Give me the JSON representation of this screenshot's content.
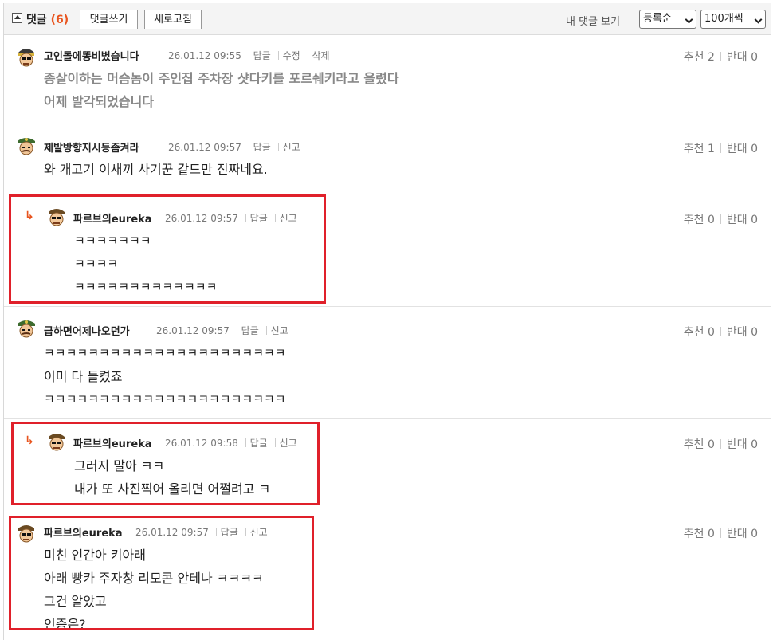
{
  "header": {
    "title": "댓글",
    "count": "(6)",
    "write_button": "댓글쓰기",
    "refresh_button": "새로고침",
    "my_comments_link": "내 댓글 보기",
    "order_select": "등록순",
    "page_size_select": "100개씩"
  },
  "comments": [
    {
      "nickname": "고인돌에똥비볐습니다",
      "datetime": "26.01.12 09:55",
      "actions": [
        "답글",
        "수정",
        "삭제"
      ],
      "recommend": "추천 2",
      "oppose": "반대 0",
      "lines": [
        "종살이하는 머슴놈이 주인집 주차장 샷다키를 포르쉐키라고 올렸다",
        "어제 발각되었습니다"
      ]
    },
    {
      "nickname": "제발방향지시등좀켜라",
      "datetime": "26.01.12 09:57",
      "actions": [
        "답글",
        "신고"
      ],
      "recommend": "추천 1",
      "oppose": "반대 0",
      "lines": [
        "와 개고기 이새끼 사기꾼 같드만 진짜네요."
      ]
    },
    {
      "reply_marker": "↳",
      "nickname": "파르브의eureka",
      "datetime": "26.01.12 09:57",
      "actions": [
        "답글",
        "신고"
      ],
      "recommend": "추천 0",
      "oppose": "반대 0",
      "lines": [
        "ㅋㅋㅋㅋㅋㅋㅋ",
        "ㅋㅋㅋㅋ",
        "ㅋㅋㅋㅋㅋㅋㅋㅋㅋㅋㅋㅋㅋ"
      ]
    },
    {
      "nickname": "급하면어제나오던가",
      "datetime": "26.01.12 09:57",
      "actions": [
        "답글",
        "신고"
      ],
      "recommend": "추천 0",
      "oppose": "반대 0",
      "lines": [
        "ㅋㅋㅋㅋㅋㅋㅋㅋㅋㅋㅋㅋㅋㅋㅋㅋㅋㅋㅋㅋㅋㅋ",
        "이미 다 들켰죠",
        "ㅋㅋㅋㅋㅋㅋㅋㅋㅋㅋㅋㅋㅋㅋㅋㅋㅋㅋㅋㅋㅋㅋ"
      ]
    },
    {
      "reply_marker": "↳",
      "nickname": "파르브의eureka",
      "datetime": "26.01.12 09:58",
      "actions": [
        "답글",
        "신고"
      ],
      "recommend": "추천 0",
      "oppose": "반대 0",
      "lines": [
        "그러지 말아 ㅋㅋ",
        "내가 또 사진찍어 올리면 어쩔려고 ㅋ"
      ]
    },
    {
      "nickname": "파르브의eureka",
      "datetime": "26.01.12 09:57",
      "actions": [
        "답글",
        "신고"
      ],
      "recommend": "추천 0",
      "oppose": "반대 0",
      "lines": [
        "미친 인간아 키아래",
        "아래 빵카 주자창 리모콘 안테나 ㅋㅋㅋㅋ",
        "그건 알았고",
        "인증은?"
      ]
    }
  ],
  "colors": {
    "accent": "#e8541e",
    "highlight_box": "#e0202a"
  }
}
